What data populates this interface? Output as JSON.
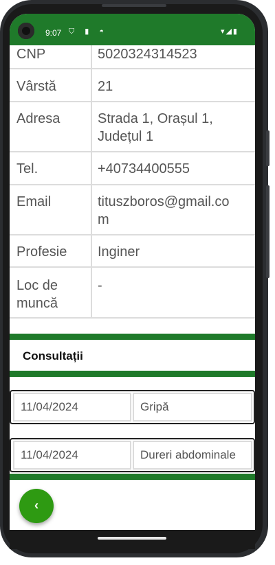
{
  "status_bar": {
    "time": "9:07",
    "left_icons": "⛉ ▮ ◓",
    "right_icons": "▾◢▮"
  },
  "patient_info": [
    {
      "label": "CNP",
      "value": "5020324314523"
    },
    {
      "label": "Vârstă",
      "value": "21"
    },
    {
      "label": "Adresa",
      "value": "Strada 1, Orașul 1, Județul 1"
    },
    {
      "label": "Tel.",
      "value": "+40734400555"
    },
    {
      "label": "Email",
      "value": "tituszboros@gmail.com"
    },
    {
      "label": "Profesie",
      "value": "Inginer"
    },
    {
      "label": "Loc de muncă",
      "value": "-"
    }
  ],
  "consultations": {
    "title": "Consultații",
    "items": [
      {
        "date": "11/04/2024",
        "description": "Gripă"
      },
      {
        "date": "11/04/2024",
        "description": "Dureri abdominale"
      }
    ]
  },
  "back_button": {
    "icon": "‹"
  },
  "colors": {
    "accent": "#1f7a2a",
    "fab": "#2e9a12"
  }
}
